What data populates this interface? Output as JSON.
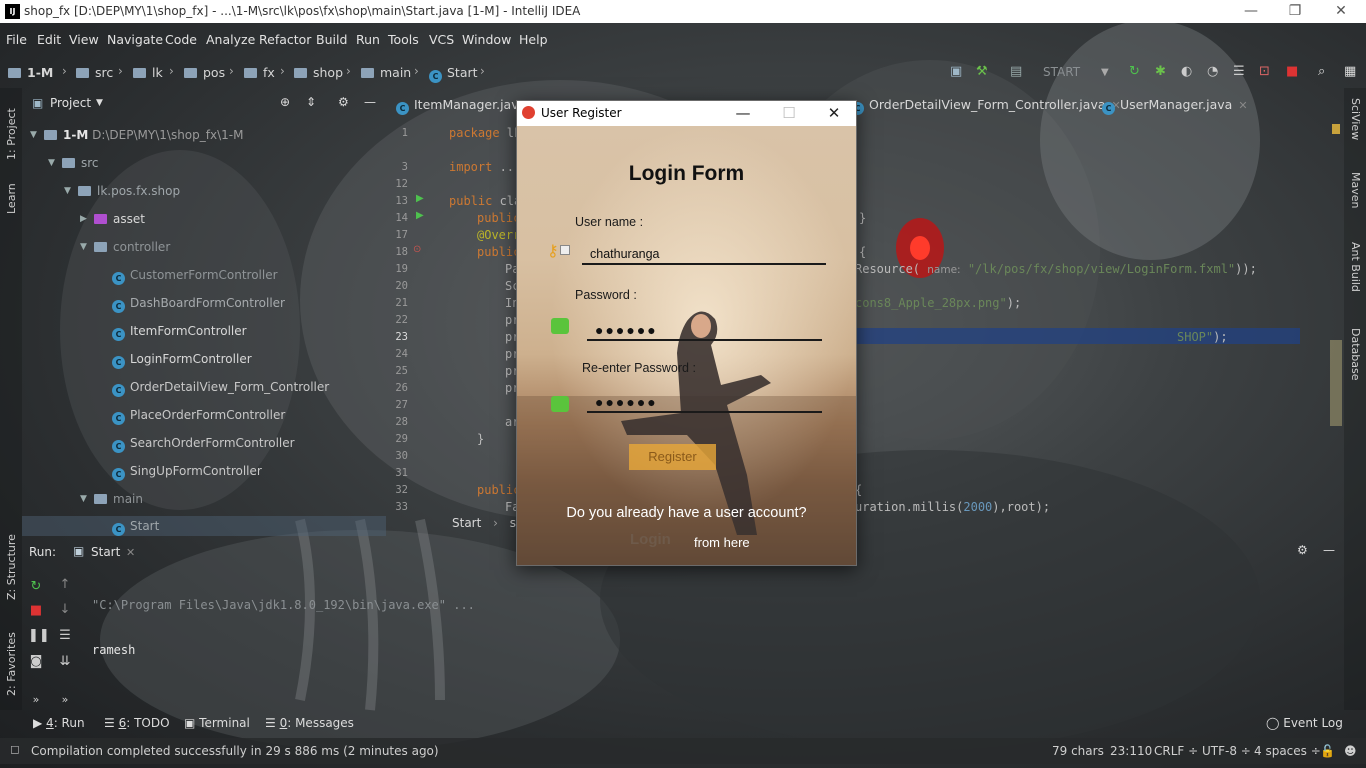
{
  "window": {
    "app_icon": "IJ",
    "title": "shop_fx [D:\\DEP\\MY\\1\\shop_fx] - ...\\1-M\\src\\lk\\pos\\fx\\shop\\main\\Start.java [1-M] - IntelliJ IDEA",
    "minimize": "—",
    "restore": "❐",
    "close": "✕"
  },
  "menu": [
    "File",
    "Edit",
    "View",
    "Navigate",
    "Code",
    "Analyze",
    "Refactor",
    "Build",
    "Run",
    "Tools",
    "VCS",
    "Window",
    "Help"
  ],
  "navbar": {
    "crumbs": [
      "1-M",
      "src",
      "lk",
      "pos",
      "fx",
      "shop",
      "main",
      "Start"
    ],
    "run_config": "START"
  },
  "left_strip": {
    "project": "1: Project",
    "learn": "Learn",
    "structure": "Z: Structure",
    "favorites": "2: Favorites"
  },
  "right_strip": {
    "sciview": "SciView",
    "maven": "Maven",
    "ant": "Ant Build",
    "database": "Database"
  },
  "project_panel": {
    "title": "Project",
    "tree": [
      {
        "label": "1-M",
        "extra": "D:\\DEP\\MY\\1\\shop_fx\\1-M",
        "kind": "module"
      },
      {
        "label": "src",
        "kind": "folder"
      },
      {
        "label": "lk.pos.fx.shop",
        "kind": "folder"
      },
      {
        "label": "asset",
        "kind": "package"
      },
      {
        "label": "controller",
        "kind": "folder"
      },
      {
        "label": "CustomerFormController",
        "kind": "class"
      },
      {
        "label": "DashBoardFormController",
        "kind": "class"
      },
      {
        "label": "ItemFormController",
        "kind": "class"
      },
      {
        "label": "LoginFormController",
        "kind": "class"
      },
      {
        "label": "OrderDetailView_Form_Controller",
        "kind": "class"
      },
      {
        "label": "PlaceOrderFormController",
        "kind": "class"
      },
      {
        "label": "SearchOrderFormController",
        "kind": "class"
      },
      {
        "label": "SingUpFormController",
        "kind": "class"
      },
      {
        "label": "main",
        "kind": "folder"
      },
      {
        "label": "Start",
        "kind": "class"
      }
    ]
  },
  "editor_tabs": [
    "ItemManager.java",
    "OrderDetailView_Form_Controller.java",
    "UserManager.java"
  ],
  "gutter_lines": [
    "1",
    "3",
    "12",
    "13",
    "14",
    "17",
    "18",
    "19",
    "20",
    "21",
    "22",
    "23",
    "24",
    "25",
    "26",
    "27",
    "28",
    "29",
    "30",
    "31",
    "32",
    "33"
  ],
  "code": [
    {
      "kw": "package ",
      "rest": "lk"
    },
    {
      "kw": "import ",
      "rest": "..."
    },
    {
      "kw": "public ",
      "rest": "cla"
    },
    {
      "kw": "public",
      "rest": ""
    },
    {
      "an": "@Overr",
      "rest": ""
    },
    {
      "kw": "public",
      "rest": ""
    },
    {
      "rest": "Pa"
    },
    {
      "rest": "Sc"
    },
    {
      "rest": "In"
    },
    {
      "rest": "pr"
    },
    {
      "rest": "pr"
    },
    {
      "rest": "pr"
    },
    {
      "rest": "pr"
    },
    {
      "rest": "pr"
    },
    {
      "rest": "ar"
    },
    {
      "rest": "}"
    },
    {
      "kw": "public",
      "rest": ""
    },
    {
      "rest": "Fa"
    }
  ],
  "code_right": {
    "line14": "}",
    "line18": "{",
    "line19_a": "Resource(",
    "line19_hint": "name:",
    "line19_str": "\"/lk/pos/fx/shop/view/LoginForm.fxml\"",
    "line19_end": "));",
    "line21_str": "cons8_Apple_28px.png\"",
    "line21_end": ");",
    "line23_str": "SHOP\"",
    "line23_end": ");",
    "line32": "{",
    "line33_a": "uration.millis(",
    "line33_num": "2000",
    "line33_b": "),root);"
  },
  "editor_breadcrumb": [
    "Start",
    "sta"
  ],
  "run_panel": {
    "label": "Run:",
    "tab": "Start",
    "output": [
      "\"C:\\Program Files\\Java\\jdk1.8.0_192\\bin\\java.exe\" ...",
      "ramesh"
    ]
  },
  "bottom_tabs": [
    {
      "num": "4",
      "label": "Run"
    },
    {
      "num": "6",
      "label": "TODO"
    },
    {
      "num": "",
      "label": "Terminal"
    },
    {
      "num": "0",
      "label": "Messages"
    },
    {
      "num": "",
      "label": "Event Log"
    }
  ],
  "status": {
    "message": "Compilation completed successfully in 29 s 886 ms (2 minutes ago)",
    "chars": "79 chars",
    "position": "23:110",
    "line_sep": "CRLF ÷",
    "encoding": "UTF-8 ÷",
    "indent": "4 spaces ÷"
  },
  "dialog": {
    "title": "User Register",
    "heading": "Login Form",
    "username_label": "User name  :",
    "username_value": "chathuranga",
    "password_label": "Password   :",
    "password_value": "●●●●●●",
    "reenter_label": "Re-enter Password   :",
    "reenter_value": "●●●●●●",
    "register_button": "Register",
    "question": "Do you already have a user account?",
    "login_link": "Login",
    "from_here": "from  here"
  },
  "colors": {
    "keyword": "#cc7832",
    "annotation": "#bbb529",
    "string": "#6a8759",
    "number": "#6897bb",
    "accent_register": "#e8a838"
  }
}
